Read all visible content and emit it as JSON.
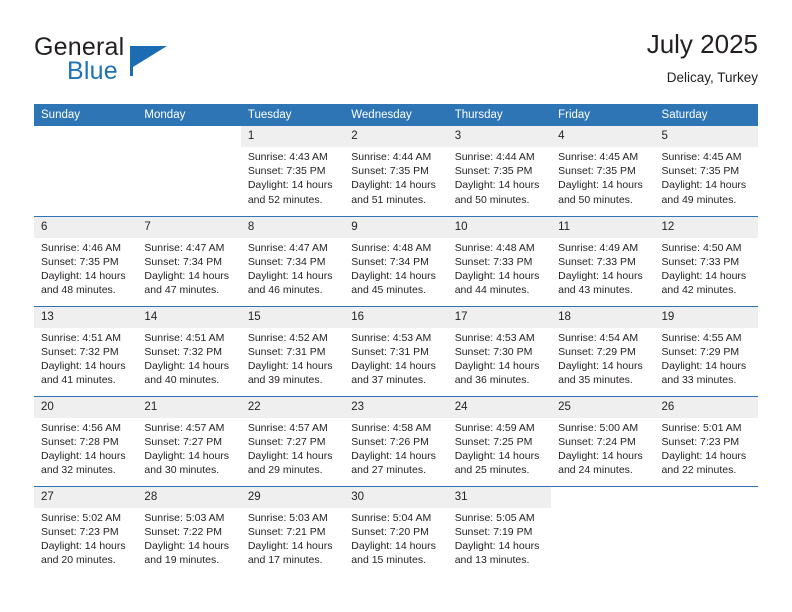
{
  "brand": {
    "line1": "General",
    "line2": "Blue",
    "flag_icon": "flag-triangle-icon",
    "accent_color": "#1b6cb3"
  },
  "header": {
    "title": "July 2025",
    "location": "Delicay, Turkey"
  },
  "colors": {
    "header_row": "#2e75b6",
    "daynum_strip": "#efefef",
    "text": "#231f20"
  },
  "weekdays": [
    "Sunday",
    "Monday",
    "Tuesday",
    "Wednesday",
    "Thursday",
    "Friday",
    "Saturday"
  ],
  "labels": {
    "sunrise": "Sunrise:",
    "sunset": "Sunset:",
    "daylight": "Daylight:"
  },
  "weeks": [
    [
      {
        "day": "",
        "sunrise": "",
        "sunset": "",
        "daylight1": "",
        "daylight2": "",
        "blank": true
      },
      {
        "day": "",
        "sunrise": "",
        "sunset": "",
        "daylight1": "",
        "daylight2": "",
        "blank": true
      },
      {
        "day": "1",
        "sunrise": "Sunrise: 4:43 AM",
        "sunset": "Sunset: 7:35 PM",
        "daylight1": "Daylight: 14 hours",
        "daylight2": "and 52 minutes."
      },
      {
        "day": "2",
        "sunrise": "Sunrise: 4:44 AM",
        "sunset": "Sunset: 7:35 PM",
        "daylight1": "Daylight: 14 hours",
        "daylight2": "and 51 minutes."
      },
      {
        "day": "3",
        "sunrise": "Sunrise: 4:44 AM",
        "sunset": "Sunset: 7:35 PM",
        "daylight1": "Daylight: 14 hours",
        "daylight2": "and 50 minutes."
      },
      {
        "day": "4",
        "sunrise": "Sunrise: 4:45 AM",
        "sunset": "Sunset: 7:35 PM",
        "daylight1": "Daylight: 14 hours",
        "daylight2": "and 50 minutes."
      },
      {
        "day": "5",
        "sunrise": "Sunrise: 4:45 AM",
        "sunset": "Sunset: 7:35 PM",
        "daylight1": "Daylight: 14 hours",
        "daylight2": "and 49 minutes."
      }
    ],
    [
      {
        "day": "6",
        "sunrise": "Sunrise: 4:46 AM",
        "sunset": "Sunset: 7:35 PM",
        "daylight1": "Daylight: 14 hours",
        "daylight2": "and 48 minutes."
      },
      {
        "day": "7",
        "sunrise": "Sunrise: 4:47 AM",
        "sunset": "Sunset: 7:34 PM",
        "daylight1": "Daylight: 14 hours",
        "daylight2": "and 47 minutes."
      },
      {
        "day": "8",
        "sunrise": "Sunrise: 4:47 AM",
        "sunset": "Sunset: 7:34 PM",
        "daylight1": "Daylight: 14 hours",
        "daylight2": "and 46 minutes."
      },
      {
        "day": "9",
        "sunrise": "Sunrise: 4:48 AM",
        "sunset": "Sunset: 7:34 PM",
        "daylight1": "Daylight: 14 hours",
        "daylight2": "and 45 minutes."
      },
      {
        "day": "10",
        "sunrise": "Sunrise: 4:48 AM",
        "sunset": "Sunset: 7:33 PM",
        "daylight1": "Daylight: 14 hours",
        "daylight2": "and 44 minutes."
      },
      {
        "day": "11",
        "sunrise": "Sunrise: 4:49 AM",
        "sunset": "Sunset: 7:33 PM",
        "daylight1": "Daylight: 14 hours",
        "daylight2": "and 43 minutes."
      },
      {
        "day": "12",
        "sunrise": "Sunrise: 4:50 AM",
        "sunset": "Sunset: 7:33 PM",
        "daylight1": "Daylight: 14 hours",
        "daylight2": "and 42 minutes."
      }
    ],
    [
      {
        "day": "13",
        "sunrise": "Sunrise: 4:51 AM",
        "sunset": "Sunset: 7:32 PM",
        "daylight1": "Daylight: 14 hours",
        "daylight2": "and 41 minutes."
      },
      {
        "day": "14",
        "sunrise": "Sunrise: 4:51 AM",
        "sunset": "Sunset: 7:32 PM",
        "daylight1": "Daylight: 14 hours",
        "daylight2": "and 40 minutes."
      },
      {
        "day": "15",
        "sunrise": "Sunrise: 4:52 AM",
        "sunset": "Sunset: 7:31 PM",
        "daylight1": "Daylight: 14 hours",
        "daylight2": "and 39 minutes."
      },
      {
        "day": "16",
        "sunrise": "Sunrise: 4:53 AM",
        "sunset": "Sunset: 7:31 PM",
        "daylight1": "Daylight: 14 hours",
        "daylight2": "and 37 minutes."
      },
      {
        "day": "17",
        "sunrise": "Sunrise: 4:53 AM",
        "sunset": "Sunset: 7:30 PM",
        "daylight1": "Daylight: 14 hours",
        "daylight2": "and 36 minutes."
      },
      {
        "day": "18",
        "sunrise": "Sunrise: 4:54 AM",
        "sunset": "Sunset: 7:29 PM",
        "daylight1": "Daylight: 14 hours",
        "daylight2": "and 35 minutes."
      },
      {
        "day": "19",
        "sunrise": "Sunrise: 4:55 AM",
        "sunset": "Sunset: 7:29 PM",
        "daylight1": "Daylight: 14 hours",
        "daylight2": "and 33 minutes."
      }
    ],
    [
      {
        "day": "20",
        "sunrise": "Sunrise: 4:56 AM",
        "sunset": "Sunset: 7:28 PM",
        "daylight1": "Daylight: 14 hours",
        "daylight2": "and 32 minutes."
      },
      {
        "day": "21",
        "sunrise": "Sunrise: 4:57 AM",
        "sunset": "Sunset: 7:27 PM",
        "daylight1": "Daylight: 14 hours",
        "daylight2": "and 30 minutes."
      },
      {
        "day": "22",
        "sunrise": "Sunrise: 4:57 AM",
        "sunset": "Sunset: 7:27 PM",
        "daylight1": "Daylight: 14 hours",
        "daylight2": "and 29 minutes."
      },
      {
        "day": "23",
        "sunrise": "Sunrise: 4:58 AM",
        "sunset": "Sunset: 7:26 PM",
        "daylight1": "Daylight: 14 hours",
        "daylight2": "and 27 minutes."
      },
      {
        "day": "24",
        "sunrise": "Sunrise: 4:59 AM",
        "sunset": "Sunset: 7:25 PM",
        "daylight1": "Daylight: 14 hours",
        "daylight2": "and 25 minutes."
      },
      {
        "day": "25",
        "sunrise": "Sunrise: 5:00 AM",
        "sunset": "Sunset: 7:24 PM",
        "daylight1": "Daylight: 14 hours",
        "daylight2": "and 24 minutes."
      },
      {
        "day": "26",
        "sunrise": "Sunrise: 5:01 AM",
        "sunset": "Sunset: 7:23 PM",
        "daylight1": "Daylight: 14 hours",
        "daylight2": "and 22 minutes."
      }
    ],
    [
      {
        "day": "27",
        "sunrise": "Sunrise: 5:02 AM",
        "sunset": "Sunset: 7:23 PM",
        "daylight1": "Daylight: 14 hours",
        "daylight2": "and 20 minutes."
      },
      {
        "day": "28",
        "sunrise": "Sunrise: 5:03 AM",
        "sunset": "Sunset: 7:22 PM",
        "daylight1": "Daylight: 14 hours",
        "daylight2": "and 19 minutes."
      },
      {
        "day": "29",
        "sunrise": "Sunrise: 5:03 AM",
        "sunset": "Sunset: 7:21 PM",
        "daylight1": "Daylight: 14 hours",
        "daylight2": "and 17 minutes."
      },
      {
        "day": "30",
        "sunrise": "Sunrise: 5:04 AM",
        "sunset": "Sunset: 7:20 PM",
        "daylight1": "Daylight: 14 hours",
        "daylight2": "and 15 minutes."
      },
      {
        "day": "31",
        "sunrise": "Sunrise: 5:05 AM",
        "sunset": "Sunset: 7:19 PM",
        "daylight1": "Daylight: 14 hours",
        "daylight2": "and 13 minutes."
      },
      {
        "day": "",
        "sunrise": "",
        "sunset": "",
        "daylight1": "",
        "daylight2": "",
        "blank": true
      },
      {
        "day": "",
        "sunrise": "",
        "sunset": "",
        "daylight1": "",
        "daylight2": "",
        "blank": true
      }
    ]
  ]
}
